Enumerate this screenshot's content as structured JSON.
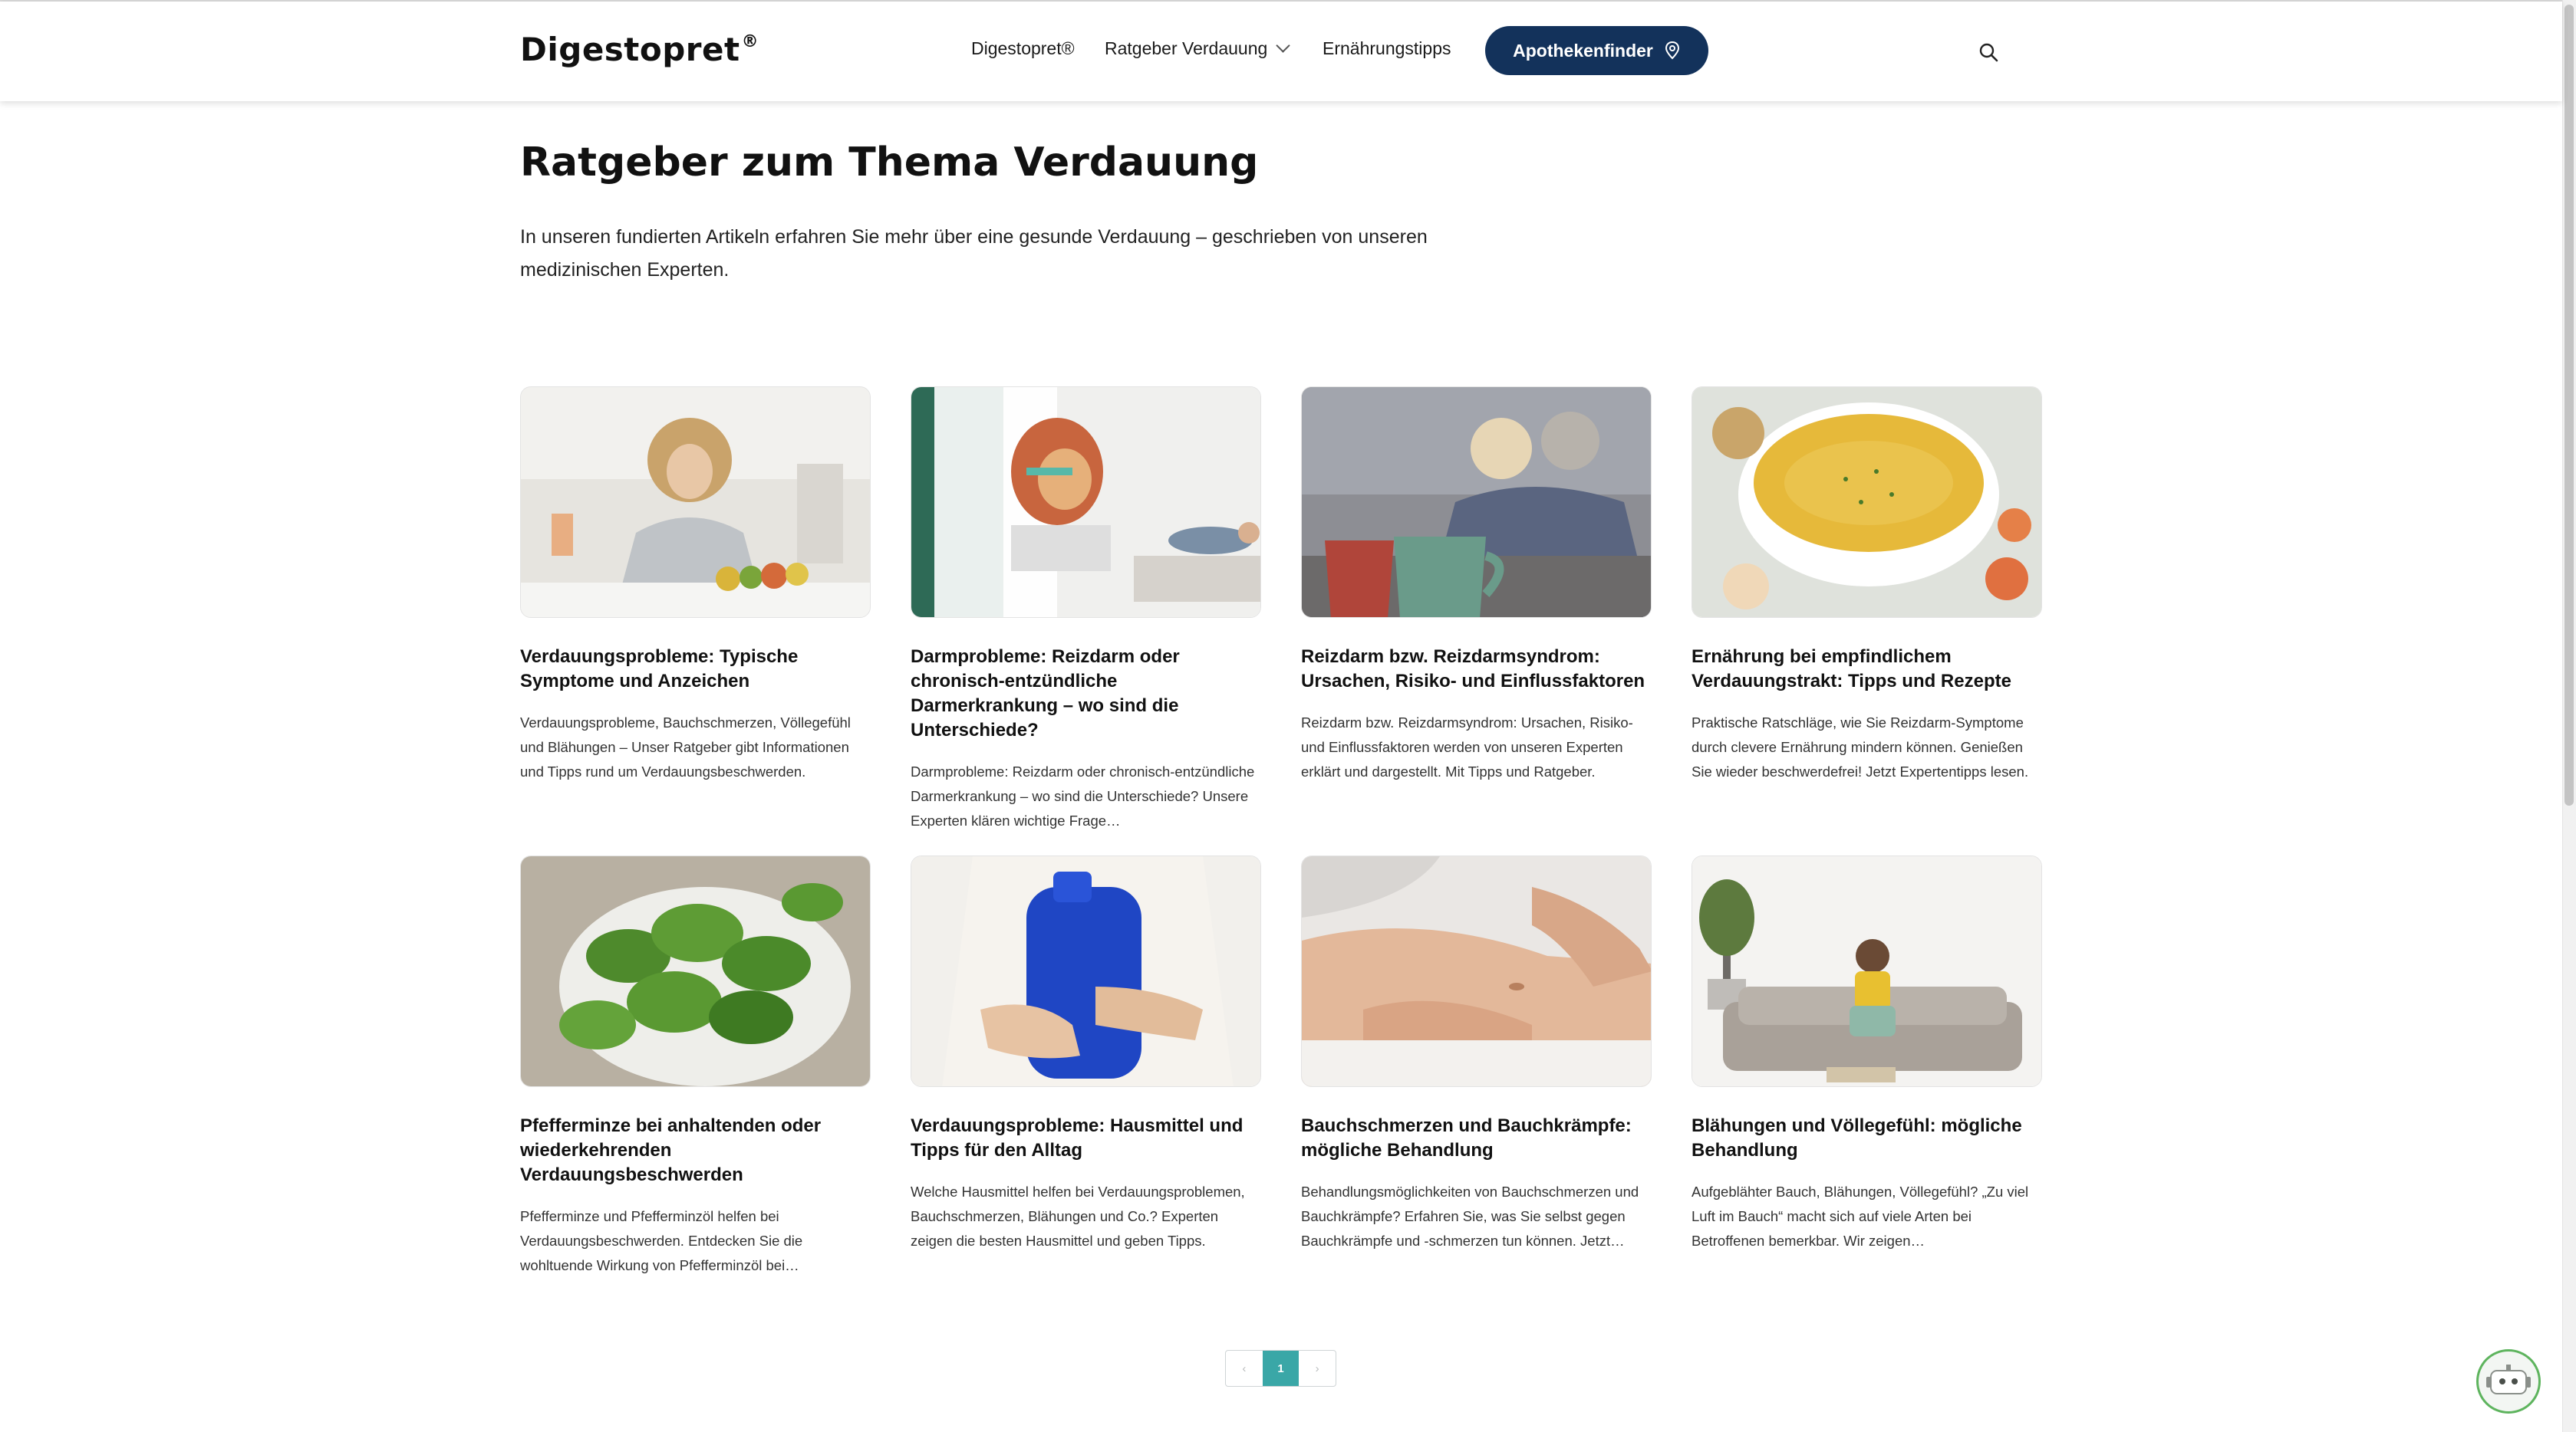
{
  "header": {
    "logo": "Digestopret",
    "logo_mark": "®",
    "nav": [
      "Digestopret®",
      "Ratgeber Verdauung",
      "Ernährungstipps"
    ],
    "cta_label": "Apothekenfinder",
    "icons": {
      "cta": "location-pin-icon",
      "search": "search-icon",
      "dropdown": "chevron-down-icon"
    }
  },
  "main": {
    "title": "Ratgeber zum Thema Verdauung",
    "intro": "In unseren fundierten Artikeln erfahren Sie mehr über eine gesunde Verdauung – geschrieben von unseren medizinischen Experten."
  },
  "articles": [
    {
      "title": "Verdauungsprobleme: Typische Symptome und Anzeichen",
      "excerpt": "Verdauungsprobleme, Bauchschmerzen, Völlegefühl und Blähungen – Unser Ratgeber gibt Informationen und Tipps rund um Verdauungsbeschwerden."
    },
    {
      "title": "Darmprobleme: Reizdarm oder chronisch-entzündliche Darmerkrankung – wo sind die Unterschiede?",
      "excerpt": "Darmprobleme: Reizdarm oder chronisch-entzündliche Darmerkrankung – wo sind die Unterschiede? Unsere Experten klären wichtige Frage…"
    },
    {
      "title": "Reizdarm bzw. Reizdarmsyndrom: Ursachen, Risiko- und Einflussfaktoren",
      "excerpt": "Reizdarm bzw. Reizdarmsyndrom: Ursachen, Risiko- und Einflussfaktoren werden von unseren Experten erklärt und dargestellt. Mit Tipps und Ratgeber."
    },
    {
      "title": "Ernährung bei empfindlichem Verdauungstrakt: Tipps und Rezepte",
      "excerpt": "Praktische Ratschläge, wie Sie Reizdarm-Symptome durch clevere Ernährung mindern können. Genießen Sie wieder beschwerdefrei! Jetzt Expertentipps lesen."
    },
    {
      "title": "Pfefferminze bei anhaltenden oder wiederkehrenden Verdauungsbeschwerden",
      "excerpt": "Pfefferminze und Pfefferminzöl helfen bei Verdauungsbeschwerden. Entdecken Sie die wohltuende Wirkung von Pfefferminzöl bei…"
    },
    {
      "title": "Verdauungsprobleme: Hausmittel und Tipps für den Alltag",
      "excerpt": "Welche Hausmittel helfen bei Verdauungsproblemen, Bauchschmerzen, Blähungen und Co.? Experten zeigen die besten Hausmittel und geben Tipps."
    },
    {
      "title": "Bauchschmerzen und Bauchkrämpfe: mögliche Behandlung",
      "excerpt": "Behandlungsmöglichkeiten von Bauchschmerzen und Bauchkrämpfe? Erfahren Sie, was Sie selbst gegen Bauchkrämpfe und -schmerzen tun können. Jetzt…"
    },
    {
      "title": "Blähungen und Völlegefühl: mögliche Behandlung",
      "excerpt": "Aufgeblähter Bauch, Blähungen, Völlegefühl? „Zu viel Luft im Bauch“ macht sich auf viele Arten bei Betroffenen bemerkbar. Wir zeigen…"
    }
  ],
  "pagination": {
    "prev": "‹",
    "current": "1",
    "next": "›"
  },
  "colors": {
    "primary": "#13325b",
    "accent": "#3aa7a7",
    "chatbot_ring": "#5eb45e"
  }
}
